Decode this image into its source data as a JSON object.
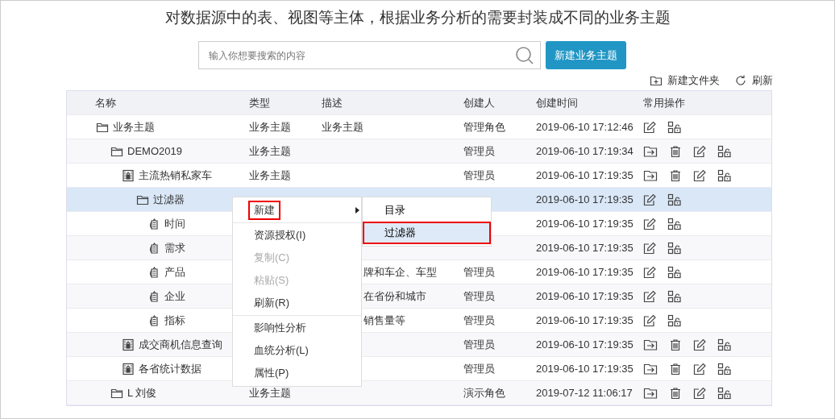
{
  "heading": "对数据源中的表、视图等主体，根据业务分析的需要封装成不同的业务主题",
  "search": {
    "placeholder": "输入你想要搜索的内容"
  },
  "create_button": "新建业务主题",
  "links": [
    {
      "kind": "folder",
      "label": "新建文件夹"
    },
    {
      "kind": "refresh",
      "label": "刷新"
    }
  ],
  "table": {
    "columns": [
      "名称",
      "类型",
      "描述",
      "创建人",
      "创建时间",
      "常用操作"
    ],
    "rows": [
      {
        "name": "业务主题",
        "kind": "folder",
        "type": "业务主题",
        "description": "业务主题",
        "creator": "管理角色",
        "created": "2019-06-10 17:12:46",
        "actions": [
          {
            "kind": "edit"
          },
          {
            "kind": "permission"
          }
        ],
        "selected": false,
        "children": [
          {
            "name": "DEMO2019",
            "kind": "folder",
            "type": "业务主题",
            "creator": "管理员",
            "created": "2019-06-10 17:19:34",
            "actions": [
              {
                "kind": "move"
              },
              {
                "kind": "delete"
              },
              {
                "kind": "edit"
              },
              {
                "kind": "permission"
              }
            ],
            "selected": false,
            "children": [
              {
                "name": "主流热销私家车",
                "kind": "theme",
                "type": "业务主题",
                "creator": "管理员",
                "created": "2019-06-10 17:19:35",
                "actions": [
                  {
                    "kind": "move"
                  },
                  {
                    "kind": "delete"
                  },
                  {
                    "kind": "edit"
                  },
                  {
                    "kind": "permission"
                  }
                ],
                "selected": false,
                "children": [
                  {
                    "name": "过滤器",
                    "kind": "folder",
                    "created": "2019-06-10 17:19:35",
                    "actions": [
                      {
                        "kind": "edit"
                      },
                      {
                        "kind": "permission"
                      }
                    ],
                    "selected": true,
                    "children": [
                      {
                        "name": "时间",
                        "kind": "field",
                        "created": "2019-06-10 17:19:35",
                        "actions": [
                          {
                            "kind": "edit"
                          },
                          {
                            "kind": "permission"
                          }
                        ],
                        "selected": false
                      },
                      {
                        "name": "需求",
                        "kind": "field",
                        "created": "2019-06-10 17:19:35",
                        "actions": [
                          {
                            "kind": "edit"
                          },
                          {
                            "kind": "permission"
                          }
                        ],
                        "selected": false
                      },
                      {
                        "name": "产品",
                        "kind": "field",
                        "description": "牌和车企、车型",
                        "covered": true,
                        "creator": "管理员",
                        "created": "2019-06-10 17:19:35",
                        "actions": [
                          {
                            "kind": "edit"
                          },
                          {
                            "kind": "permission"
                          }
                        ],
                        "selected": false
                      },
                      {
                        "name": "企业",
                        "kind": "field",
                        "description": "在省份和城市",
                        "covered": true,
                        "creator": "管理员",
                        "created": "2019-06-10 17:19:35",
                        "actions": [
                          {
                            "kind": "edit"
                          },
                          {
                            "kind": "permission"
                          }
                        ],
                        "selected": false
                      },
                      {
                        "name": "指标",
                        "kind": "field",
                        "description": "销售量等",
                        "covered": true,
                        "creator": "管理员",
                        "created": "2019-06-10 17:19:35",
                        "actions": [
                          {
                            "kind": "edit"
                          },
                          {
                            "kind": "permission"
                          }
                        ],
                        "selected": false
                      }
                    ]
                  }
                ]
              },
              {
                "name": "成交商机信息查询",
                "kind": "theme",
                "creator": "管理员",
                "created": "2019-06-10 17:19:35",
                "actions": [
                  {
                    "kind": "move"
                  },
                  {
                    "kind": "delete"
                  },
                  {
                    "kind": "edit"
                  },
                  {
                    "kind": "permission"
                  }
                ],
                "selected": false
              },
              {
                "name": "各省统计数据",
                "kind": "theme",
                "creator": "管理员",
                "created": "2019-06-10 17:19:35",
                "actions": [
                  {
                    "kind": "move"
                  },
                  {
                    "kind": "delete"
                  },
                  {
                    "kind": "edit"
                  },
                  {
                    "kind": "permission"
                  }
                ],
                "selected": false
              }
            ]
          },
          {
            "name": "L 刘俊",
            "kind": "folder",
            "type": "业务主题",
            "creator": "演示角色",
            "created": "2019-07-12 11:06:17",
            "actions": [
              {
                "kind": "move"
              },
              {
                "kind": "delete"
              },
              {
                "kind": "edit"
              },
              {
                "kind": "permission"
              }
            ],
            "selected": false
          }
        ]
      }
    ]
  },
  "context_menu": {
    "items": [
      {
        "kind": "item",
        "label": "新建",
        "submenu": true,
        "disabled": false,
        "outlined": true
      },
      {
        "kind": "divider"
      },
      {
        "kind": "item",
        "label": "资源授权(I)",
        "submenu": false,
        "disabled": false,
        "outlined": false
      },
      {
        "kind": "item",
        "label": "复制(C)",
        "submenu": false,
        "disabled": true,
        "outlined": false
      },
      {
        "kind": "item",
        "label": "粘贴(S)",
        "submenu": false,
        "disabled": true,
        "outlined": false
      },
      {
        "kind": "item",
        "label": "刷新(R)",
        "submenu": false,
        "disabled": false,
        "outlined": false
      },
      {
        "kind": "divider"
      },
      {
        "kind": "item",
        "label": "影响性分析",
        "submenu": false,
        "disabled": false,
        "outlined": false
      },
      {
        "kind": "item",
        "label": "血统分析(L)",
        "submenu": false,
        "disabled": false,
        "outlined": false
      },
      {
        "kind": "item",
        "label": "属性(P)",
        "submenu": false,
        "disabled": false,
        "outlined": false
      }
    ],
    "submenu": [
      {
        "label": "目录",
        "selected": false,
        "outlined": false
      },
      {
        "label": "过滤器",
        "selected": true,
        "outlined": true
      }
    ]
  }
}
